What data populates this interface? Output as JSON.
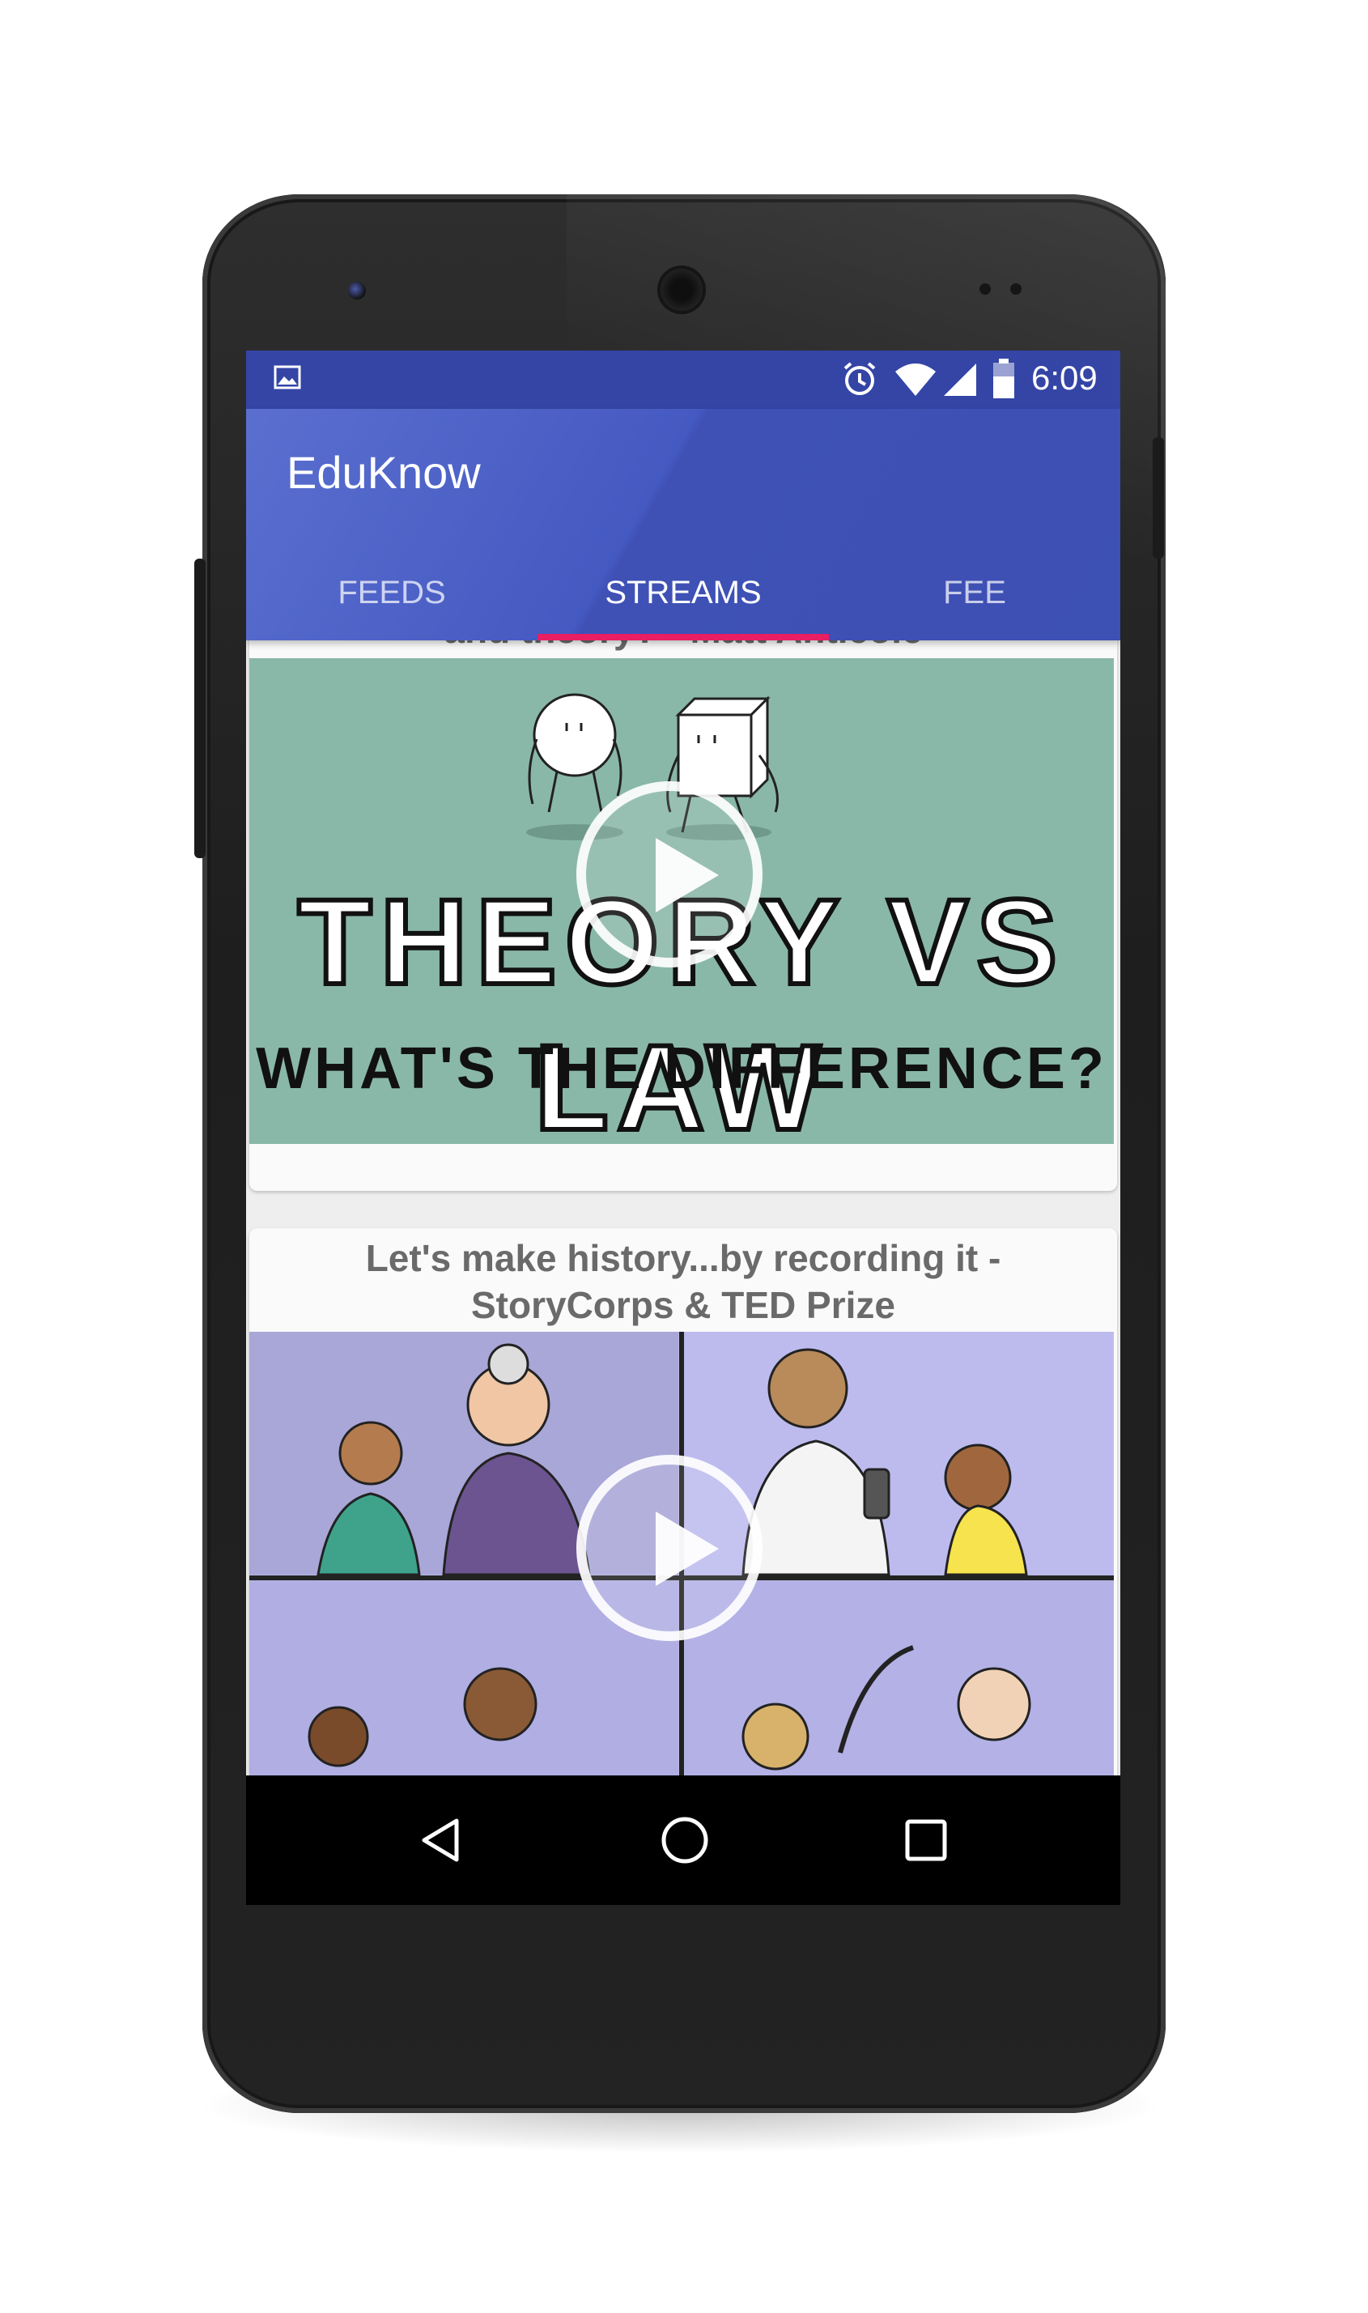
{
  "status_bar": {
    "time": "6:09",
    "icons": [
      "image-icon",
      "alarm-icon",
      "wifi-icon",
      "signal-icon",
      "battery-icon"
    ]
  },
  "app": {
    "title": "EduKnow"
  },
  "tabs": [
    {
      "label": "FEEDS",
      "active": false
    },
    {
      "label": "STREAMS",
      "active": true
    },
    {
      "label": "FEE",
      "active": false
    }
  ],
  "feed": {
    "items": [
      {
        "title_partial": "and theory? - Matt Anticole",
        "thumbnail": {
          "headline": "THEORY VS LAW",
          "subline": "WHAT'S THE DIFFERENCE?",
          "background": "#8ab8a8"
        }
      },
      {
        "title_line1": "Let's make history...by recording it -",
        "title_line2": "StoryCorps & TED Prize",
        "thumbnail": {
          "background": "#b9b7e3"
        }
      }
    ]
  },
  "navigation": {
    "buttons": [
      "back-icon",
      "home-icon",
      "recents-icon"
    ]
  },
  "colors": {
    "primary": "#3f51b5",
    "primary_dark": "#3445a6",
    "accent": "#e91e63",
    "card_title": "#6a6a6a"
  }
}
